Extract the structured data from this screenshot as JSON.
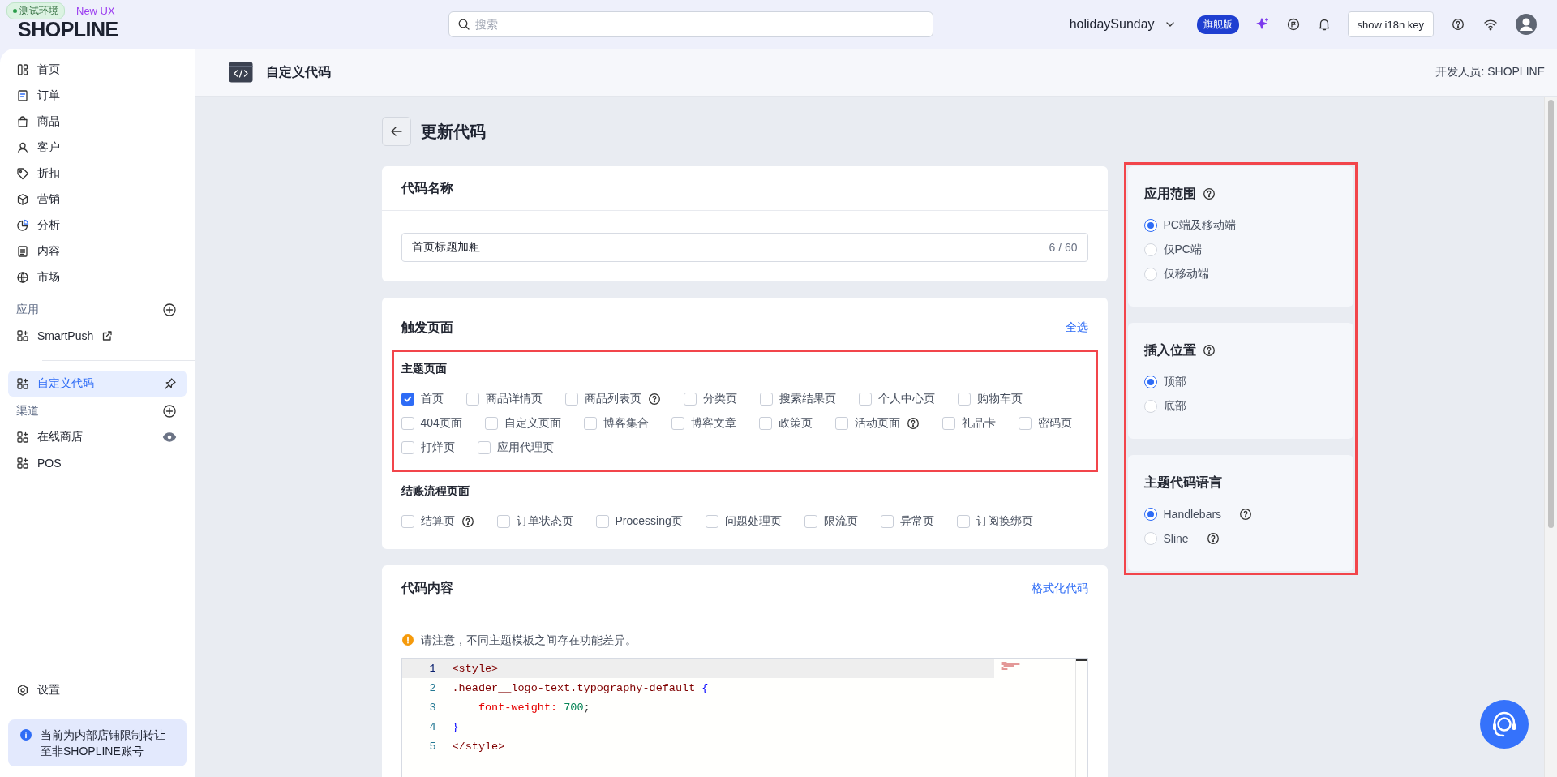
{
  "top_bar": {
    "environment_badge": "测试环境",
    "ux_badge": "New UX",
    "logo": "SHOPLINE",
    "search": {
      "placeholder": "搜索"
    },
    "store_name": "holidaySunday",
    "plan_badge": "旗舰版",
    "i18n_button": "show i18n key"
  },
  "sidebar": {
    "items": [
      {
        "label": "首页",
        "selected": false
      },
      {
        "label": "订单",
        "selected": false
      },
      {
        "label": "商品",
        "selected": false
      },
      {
        "label": "客户",
        "selected": false
      },
      {
        "label": "折扣",
        "selected": false
      },
      {
        "label": "营销",
        "selected": false
      },
      {
        "label": "分析",
        "selected": false
      },
      {
        "label": "内容",
        "selected": false
      },
      {
        "label": "市场",
        "selected": false
      }
    ],
    "apps": {
      "title": "应用",
      "items": [
        {
          "label": "SmartPush",
          "selected": false
        }
      ]
    },
    "pinned": {
      "label": "自定义代码",
      "selected": true
    },
    "channels": {
      "title": "渠道",
      "items": [
        {
          "label": "在线商店",
          "selected": false
        },
        {
          "label": "POS",
          "selected": false
        }
      ]
    },
    "settings": {
      "label": "设置",
      "selected": false
    },
    "notice": "当前为内部店铺限制转让至非SHOPLINE账号"
  },
  "page_header": {
    "title": "自定义代码",
    "developer": "开发人员: SHOPLINE"
  },
  "form": {
    "title": "更新代码",
    "name_card": {
      "title": "代码名称",
      "value": "首页标题加粗",
      "counter": "6 / 60"
    },
    "trigger_card": {
      "title": "触发页面",
      "select_all": "全选",
      "groups": [
        {
          "title": "主题页面",
          "highlighted": true,
          "options": [
            {
              "label": "首页",
              "checked": true,
              "help": false
            },
            {
              "label": "商品详情页",
              "checked": false,
              "help": false
            },
            {
              "label": "商品列表页",
              "checked": false,
              "help": true
            },
            {
              "label": "分类页",
              "checked": false,
              "help": false
            },
            {
              "label": "搜索结果页",
              "checked": false,
              "help": false
            },
            {
              "label": "个人中心页",
              "checked": false,
              "help": false
            },
            {
              "label": "购物车页",
              "checked": false,
              "help": false
            },
            {
              "label": "404页面",
              "checked": false,
              "help": false
            },
            {
              "label": "自定义页面",
              "checked": false,
              "help": false
            },
            {
              "label": "博客集合",
              "checked": false,
              "help": false
            },
            {
              "label": "博客文章",
              "checked": false,
              "help": false
            },
            {
              "label": "政策页",
              "checked": false,
              "help": false
            },
            {
              "label": "活动页面",
              "checked": false,
              "help": true
            },
            {
              "label": "礼品卡",
              "checked": false,
              "help": false
            },
            {
              "label": "密码页",
              "checked": false,
              "help": false
            },
            {
              "label": "打烊页",
              "checked": false,
              "help": false
            },
            {
              "label": "应用代理页",
              "checked": false,
              "help": false
            }
          ]
        },
        {
          "title": "结账流程页面",
          "highlighted": false,
          "options": [
            {
              "label": "结算页",
              "checked": false,
              "help": true
            },
            {
              "label": "订单状态页",
              "checked": false,
              "help": false
            },
            {
              "label": "Processing页",
              "checked": false,
              "help": false
            },
            {
              "label": "问题处理页",
              "checked": false,
              "help": false
            },
            {
              "label": "限流页",
              "checked": false,
              "help": false
            },
            {
              "label": "异常页",
              "checked": false,
              "help": false
            },
            {
              "label": "订阅换绑页",
              "checked": false,
              "help": false
            }
          ]
        }
      ]
    },
    "code_card": {
      "title": "代码内容",
      "format_link": "格式化代码",
      "notice": "请注意，不同主题模板之间存在功能差异。",
      "lines": [
        {
          "number": "1",
          "active": true,
          "tokens": [
            {
              "kind": "tag",
              "text": "<style>"
            }
          ]
        },
        {
          "number": "2",
          "active": false,
          "tokens": [
            {
              "kind": "selector",
              "text": ".header__logo-text.typography-default"
            },
            {
              "kind": "brace",
              "text": " {"
            }
          ]
        },
        {
          "number": "3",
          "active": false,
          "tokens": [
            {
              "kind": "property",
              "text": "    font-weight:"
            },
            {
              "kind": "number",
              "text": " 700"
            },
            {
              "kind": "punct",
              "text": ";"
            }
          ]
        },
        {
          "number": "4",
          "active": false,
          "tokens": [
            {
              "kind": "brace",
              "text": "}"
            }
          ]
        },
        {
          "number": "5",
          "active": false,
          "tokens": [
            {
              "kind": "tag",
              "text": "</style>"
            }
          ]
        }
      ]
    }
  },
  "settings_panel": {
    "highlighted": true,
    "sections": [
      {
        "title": "应用范围",
        "help": true,
        "options": [
          {
            "label": "PC端及移动端",
            "selected": true,
            "help": false
          },
          {
            "label": "仅PC端",
            "selected": false,
            "help": false
          },
          {
            "label": "仅移动端",
            "selected": false,
            "help": false
          }
        ]
      },
      {
        "title": "插入位置",
        "help": true,
        "options": [
          {
            "label": "顶部",
            "selected": true,
            "help": false
          },
          {
            "label": "底部",
            "selected": false,
            "help": false
          }
        ]
      },
      {
        "title": "主题代码语言",
        "help": false,
        "options": [
          {
            "label": "Handlebars",
            "selected": true,
            "help": true
          },
          {
            "label": "Sline",
            "selected": false,
            "help": true
          }
        ]
      }
    ]
  }
}
